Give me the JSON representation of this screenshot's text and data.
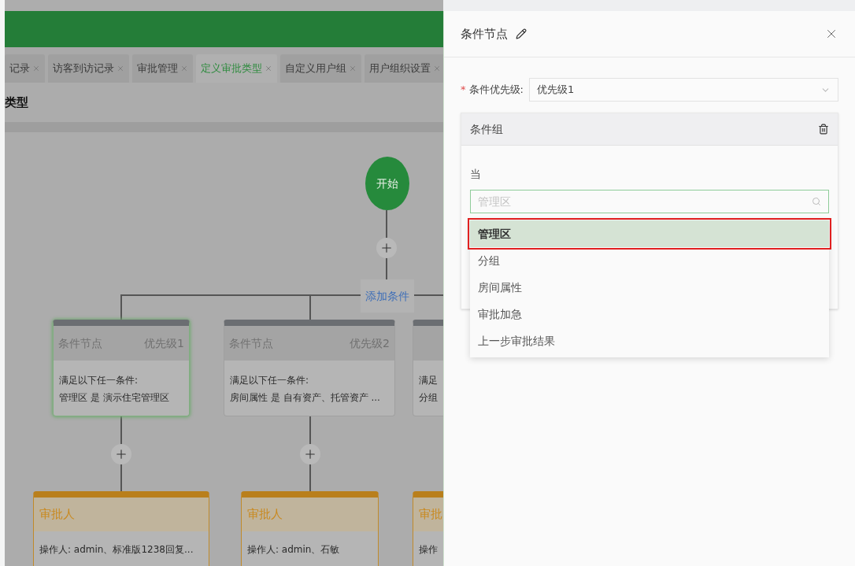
{
  "tabs": [
    {
      "label": "记录",
      "selected": false
    },
    {
      "label": "访客到访记录",
      "selected": false
    },
    {
      "label": "审批管理",
      "selected": false
    },
    {
      "label": "定义审批类型",
      "selected": true
    },
    {
      "label": "自定义用户组",
      "selected": false
    },
    {
      "label": "用户组织设置",
      "selected": false
    }
  ],
  "page_title": "类型",
  "flow": {
    "start": "开始",
    "add_condition": "添加条件",
    "conditions": [
      {
        "title": "条件节点",
        "priority": "优先级1",
        "lines": [
          "满足以下任一条件:",
          "管理区 是 演示住宅管理区"
        ],
        "selected": true
      },
      {
        "title": "条件节点",
        "priority": "优先级2",
        "lines": [
          "满足以下任一条件:",
          "房间属性 是 自有资产、托管资产 ..."
        ],
        "selected": false
      },
      {
        "lines": [
          "满足",
          "分组"
        ],
        "selected": false
      }
    ],
    "approvers": [
      {
        "title": "审批人",
        "text": "操作人: admin、标准版1238回复..."
      },
      {
        "title": "审批人",
        "text": "操作人: admin、石敏"
      },
      {
        "title": "审批",
        "text": "操作"
      }
    ]
  },
  "panel": {
    "title": "条件节点",
    "priority_field": {
      "required_mark": "*",
      "label": "条件优先级:",
      "value": "优先级1"
    },
    "condition_group": {
      "title": "条件组",
      "when_label": "当",
      "search": {
        "placeholder": "管理区"
      },
      "options": [
        {
          "label": "管理区",
          "selected": true
        },
        {
          "label": "分组",
          "selected": false
        },
        {
          "label": "房间属性",
          "selected": false
        },
        {
          "label": "审批加急",
          "selected": false
        },
        {
          "label": "上一步审批结果",
          "selected": false
        }
      ]
    }
  }
}
